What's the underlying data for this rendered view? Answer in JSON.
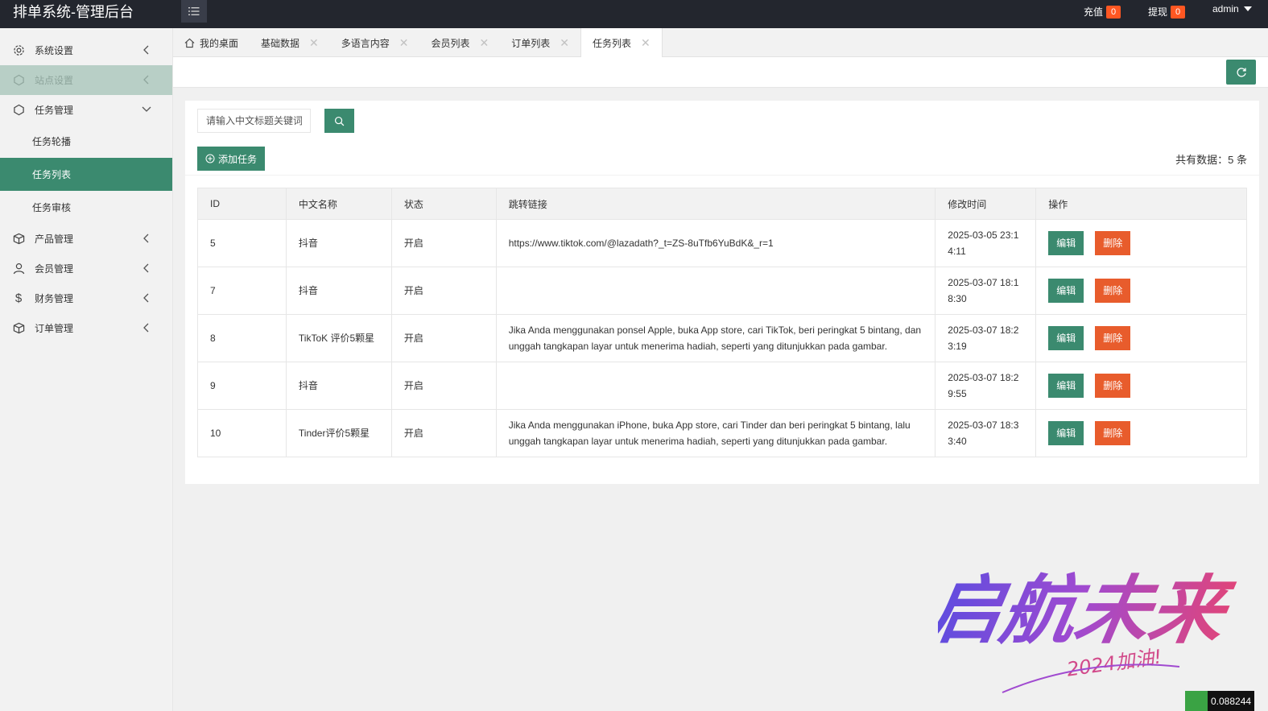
{
  "header": {
    "title": "排单系统-管理后台",
    "recharge_label": "充值",
    "recharge_count": "0",
    "withdraw_label": "提现",
    "withdraw_count": "0",
    "user": "admin"
  },
  "sidebar": {
    "items": [
      {
        "label": "系统设置"
      },
      {
        "label": "站点设置"
      },
      {
        "label": "任务管理"
      },
      {
        "label": "任务轮播"
      },
      {
        "label": "任务列表"
      },
      {
        "label": "任务审核"
      },
      {
        "label": "产品管理"
      },
      {
        "label": "会员管理"
      },
      {
        "label": "财务管理"
      },
      {
        "label": "订单管理"
      }
    ]
  },
  "tabs": [
    {
      "label": "我的桌面"
    },
    {
      "label": "基础数据"
    },
    {
      "label": "多语言内容"
    },
    {
      "label": "会员列表"
    },
    {
      "label": "订单列表"
    },
    {
      "label": "任务列表"
    }
  ],
  "toolbar": {
    "search_placeholder": "请输入中文标题关键词",
    "add_label": "添加任务",
    "total_text": "共有数据：5 条"
  },
  "table": {
    "columns": [
      "ID",
      "中文名称",
      "状态",
      "跳转链接",
      "修改时间",
      "操作"
    ],
    "edit_label": "编辑",
    "delete_label": "删除",
    "rows": [
      {
        "id": "5",
        "name": "抖音",
        "status": "开启",
        "link": "https://www.tiktok.com/@lazadath?_t=ZS-8uTfb6YuBdK&_r=1",
        "time": "2025-03-05 23:14:11"
      },
      {
        "id": "7",
        "name": "抖音",
        "status": "开启",
        "link": "",
        "time": "2025-03-07 18:18:30"
      },
      {
        "id": "8",
        "name": "TikToK 评价5颗星",
        "status": "开启",
        "link": "Jika Anda menggunakan ponsel Apple, buka App store, cari TikTok, beri peringkat 5 bintang, dan unggah tangkapan layar untuk menerima hadiah, seperti yang ditunjukkan pada gambar.",
        "time": "2025-03-07 18:23:19"
      },
      {
        "id": "9",
        "name": "抖音",
        "status": "开启",
        "link": "",
        "time": "2025-03-07 18:29:55"
      },
      {
        "id": "10",
        "name": "Tinder评价5颗星",
        "status": "开启",
        "link": "Jika Anda menggunakan iPhone, buka App store, cari Tinder dan beri peringkat 5 bintang, lalu unggah tangkapan layar untuk menerima hadiah, seperti yang ditunjukkan pada gambar.",
        "time": "2025-03-07 18:33:40"
      }
    ]
  },
  "watermark": {
    "text": "启航未来",
    "subtext": "2024加油!"
  },
  "corner_readout": "0.088244",
  "colors": {
    "header_bg": "#23262e",
    "primary": "#3b8a6f",
    "danger": "#e85c2c",
    "badge": "#ff5722"
  }
}
